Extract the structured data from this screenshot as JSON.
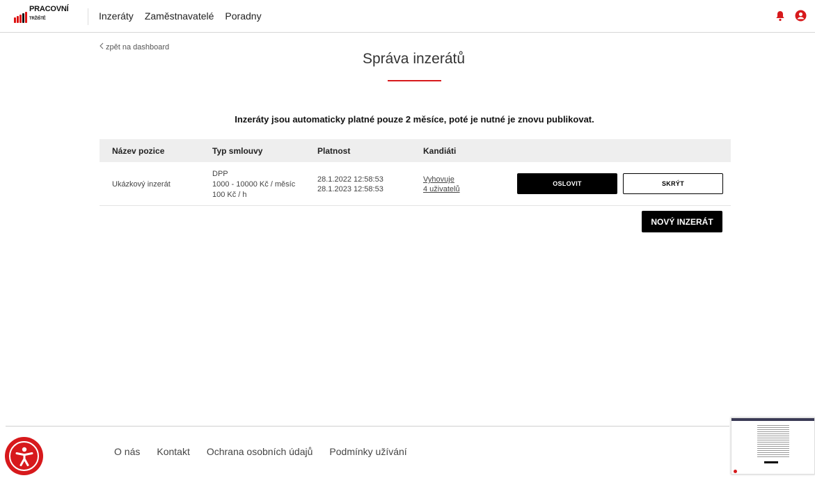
{
  "header": {
    "logo_text": "PRACOVNÍ",
    "logo_text_small": "TRŽIŠTĚ",
    "nav": [
      "Inzeráty",
      "Zaměstnavatelé",
      "Poradny"
    ],
    "icons": [
      "bell-icon",
      "user-circle-icon"
    ]
  },
  "main": {
    "back_label": "zpět na dashboard",
    "title": "Správa inzerátů",
    "notice": "Inzeráty jsou automaticky platné pouze 2 měsíce, poté je nutné je znovu publikovat.",
    "accent_color": "#d7191c",
    "table": {
      "headers": [
        "Název pozice",
        "Typ smlouvy",
        "Platnost",
        "Kandiáti"
      ],
      "rows": [
        {
          "name": "Ukázkový inzerát",
          "contract_type": "DPP",
          "salary_month": "1000 - 10000 Kč / měsíc",
          "salary_hour": "100 Kč / h",
          "valid_from": "28.1.2022 12:58:53",
          "valid_to": "28.1.2023 12:58:53",
          "candidates_line1": "Vyhovuje",
          "candidates_line2": "4 uživatelů",
          "action_primary": "OSLOVIT",
          "action_secondary": "SKRÝT"
        }
      ]
    },
    "new_button": "NOVÝ INZERÁT"
  },
  "footer": {
    "links": [
      "O nás",
      "Kontakt",
      "Ochrana osobních údajů",
      "Podmínky užívání"
    ]
  }
}
